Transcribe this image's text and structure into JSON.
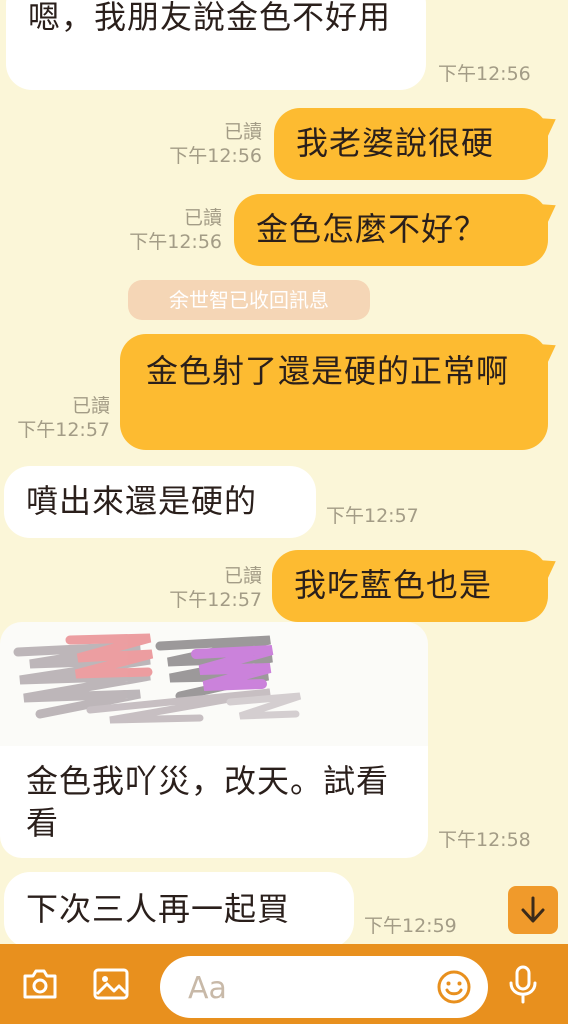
{
  "messages": [
    {
      "text": "嗯，我朋友說金色不好用"
    },
    {
      "time": "下午12:56"
    },
    {
      "text": "我老婆說很硬",
      "read": "已讀",
      "time": "下午12:56"
    },
    {
      "text": "金色怎麼不好？",
      "read": "已讀",
      "time": "下午12:56"
    },
    {
      "text": "金色射了還是硬的正常啊",
      "read": "已讀",
      "time": "下午12:57"
    },
    {
      "text": "噴出來還是硬的",
      "time": "下午12:57"
    },
    {
      "text": "我吃藍色也是",
      "read": "已讀",
      "time": "下午12:57"
    },
    {
      "text": "金色我吖災，改天。試看看",
      "time": "下午12:58"
    },
    {
      "text": "下次三人再一起買",
      "time": "下午12:59"
    }
  ],
  "system_notice": "余世智已收回訊息",
  "input": {
    "placeholder": "Aa"
  },
  "icons": {
    "camera": "camera-icon",
    "image": "image-icon",
    "emoji": "emoji-icon",
    "mic": "microphone-icon",
    "scroll": "arrow-down-icon"
  },
  "colors": {
    "background": "#FBF6D8",
    "my_bubble": "#FDBB31",
    "toolbar": "#E8901E"
  }
}
